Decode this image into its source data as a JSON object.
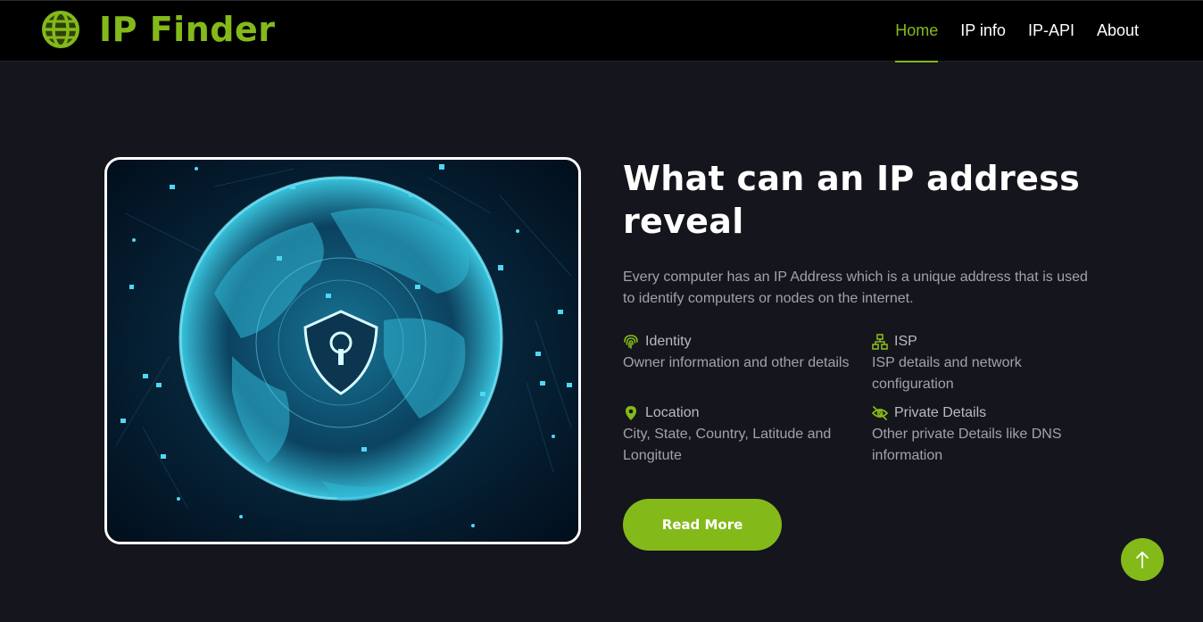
{
  "navbar": {
    "brand": "IP Finder",
    "brand_icon": "globe-icon",
    "links": [
      {
        "label": "Home",
        "active": true
      },
      {
        "label": "IP info",
        "active": false
      },
      {
        "label": "IP-API",
        "active": false
      },
      {
        "label": "About",
        "active": false
      }
    ]
  },
  "hero": {
    "image": "globe-security-illustration",
    "title": "What can an IP address reveal",
    "description": "Every computer has an IP Address which is a unique address that is used to identify computers or nodes on the internet.",
    "features": [
      {
        "icon": "fingerprint-icon",
        "title": "Identity",
        "text": "Owner information and other details"
      },
      {
        "icon": "network-icon",
        "title": "ISP",
        "text": "ISP details and network configuration"
      },
      {
        "icon": "location-pin-icon",
        "title": "Location",
        "text": "City, State, Country, Latitude and Longitute"
      },
      {
        "icon": "eye-slash-icon",
        "title": "Private Details",
        "text": "Other private Details like DNS information"
      }
    ],
    "button": "Read More"
  },
  "scroll_top_icon": "arrow-up-icon",
  "colors": {
    "accent": "#84b91a",
    "background": "#15151d",
    "navbar": "#000000"
  }
}
